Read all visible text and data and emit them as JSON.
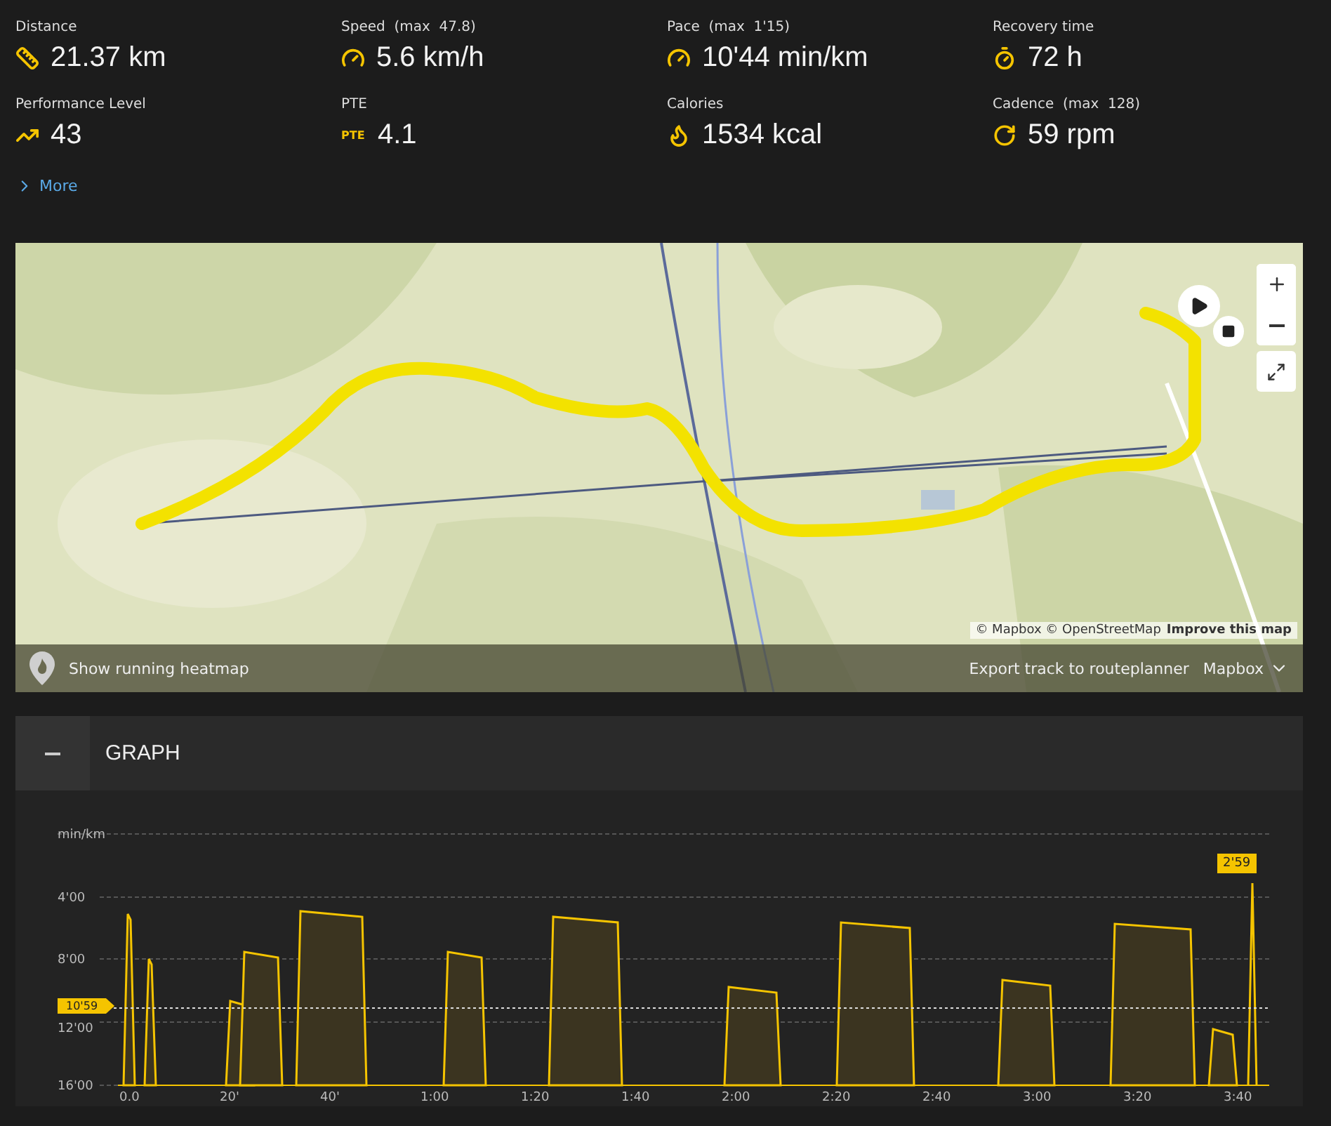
{
  "stats": [
    {
      "kind": "ruler",
      "label": "Distance",
      "value": "21.37 km"
    },
    {
      "kind": "gauge",
      "label": "Speed",
      "max": "(max  47.8)",
      "value": "5.6 km/h"
    },
    {
      "kind": "gauge",
      "label": "Pace",
      "max": "(max  1'15)",
      "value": "10'44 min/km"
    },
    {
      "kind": "timer",
      "label": "Recovery time",
      "value": "72 h"
    },
    {
      "kind": "trend",
      "label": "Performance Level",
      "value": "43"
    },
    {
      "kind": "badge",
      "badge": "PTE",
      "label": "PTE",
      "value": "4.1"
    },
    {
      "kind": "flame",
      "label": "Calories",
      "value": "1534 kcal"
    },
    {
      "kind": "cycle",
      "label": "Cadence",
      "max": "(max  128)",
      "value": "59 rpm"
    }
  ],
  "more_link": "More",
  "map": {
    "attribution": "© Mapbox © OpenStreetMap",
    "improve_link": "Improve this map",
    "heatmap_label": "Show running heatmap",
    "export_link": "Export track to routeplanner",
    "style_select": "Mapbox"
  },
  "graph": {
    "title": "GRAPH",
    "expanded": true,
    "unit": "min/km",
    "y_ticks": [
      "4'00",
      "8'00",
      "12'00",
      "16'00"
    ],
    "x_ticks": [
      "0.0",
      "20'",
      "40'",
      "1:00",
      "1:20",
      "1:40",
      "2:00",
      "2:20",
      "2:40",
      "3:00",
      "3:20",
      "3:40"
    ],
    "average_marker": "10'59",
    "peak_marker": "2'59"
  }
}
